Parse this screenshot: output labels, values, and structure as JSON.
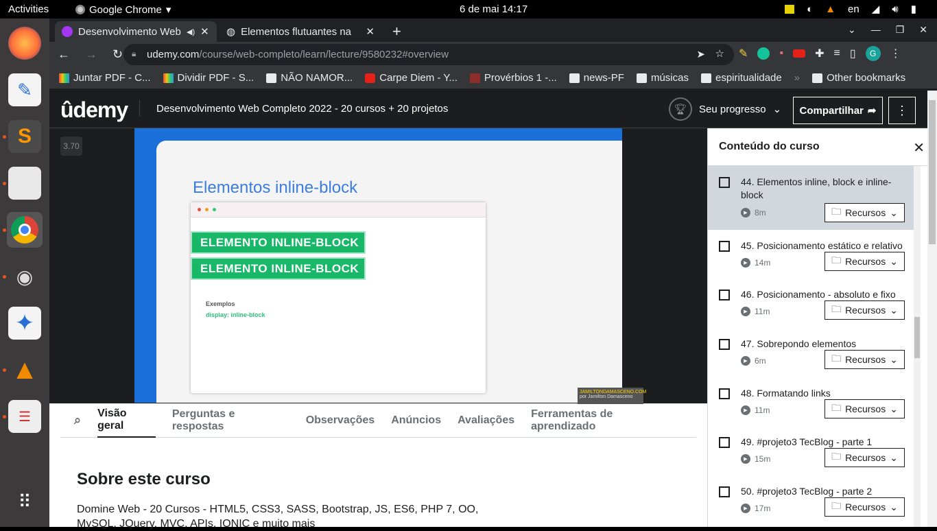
{
  "system": {
    "activities": "Activities",
    "app_name": "Google Chrome",
    "clock": "6 de mai  14:17",
    "lang": "en"
  },
  "browser": {
    "tabs": [
      {
        "title": "Desenvolvimento Web"
      },
      {
        "title": "Elementos flutuantes na"
      }
    ],
    "url_domain": "udemy.com",
    "url_path": "/course/web-completo/learn/lecture/9580232#overview",
    "bookmarks": [
      "Juntar PDF - C...",
      "Dividir PDF - S...",
      "NÃO NAMOR...",
      "Carpe Diem - Y...",
      "Provérbios 1 -...",
      "news-PF",
      "músicas",
      "espiritualidade"
    ],
    "other_bookmarks": "Other bookmarks"
  },
  "udemy": {
    "logo": "ûdemy",
    "course_title": "Desenvolvimento Web Completo 2022 - 20 cursos + 20 projetos",
    "progress_label": "Seu progresso",
    "share_label": "Compartilhar",
    "player": {
      "speed": "3.70",
      "slide_title": "Elementos inline-block",
      "block1": "ELEMENTO INLINE-BLOCK",
      "block2": "ELEMENTO INLINE-BLOCK",
      "examples_label": "Exemplos",
      "code_sample": "display: inline-block",
      "watermark_line1": "JAMILTONDAMASCENO.COM",
      "watermark_line2": "por Jamilton Damasceno"
    },
    "tabs": [
      "Visão geral",
      "Perguntas e respostas",
      "Observações",
      "Anúncios",
      "Avaliações",
      "Ferramentas de aprendizado"
    ],
    "about_title": "Sobre este curso",
    "about_desc": "Domine Web - 20 Cursos - HTML5, CSS3, SASS, Bootstrap, JS, ES6, PHP 7, OO, MySQL, JQuery, MVC, APIs, IONIC e muito mais"
  },
  "sidebar": {
    "title": "Conteúdo do curso",
    "resources_label": "Recursos",
    "lectures": [
      {
        "name": "44. Elementos inline, block e inline-block",
        "duration": "8m",
        "current": true
      },
      {
        "name": "45. Posicionamento estático e relativo",
        "duration": "14m"
      },
      {
        "name": "46. Posicionamento - absoluto e fixo",
        "duration": "11m"
      },
      {
        "name": "47. Sobrepondo elementos",
        "duration": "6m"
      },
      {
        "name": "48. Formatando links",
        "duration": "11m"
      },
      {
        "name": "49. #projeto3 TecBlog - parte 1",
        "duration": "15m"
      },
      {
        "name": "50. #projeto3 TecBlog - parte 2",
        "duration": "17m"
      }
    ]
  }
}
